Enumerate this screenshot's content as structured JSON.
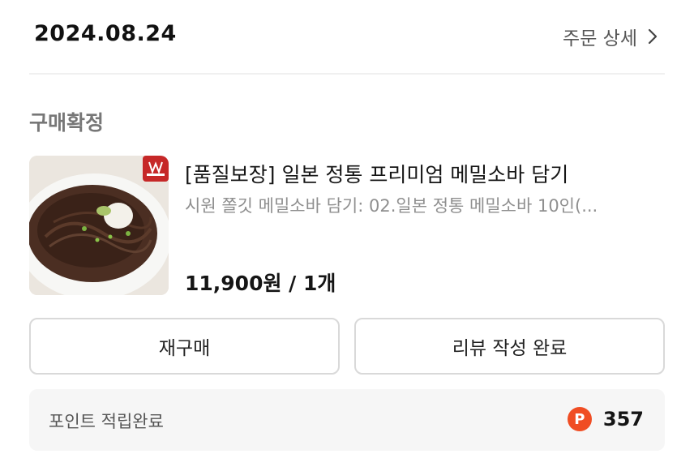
{
  "order": {
    "date": "2024.08.24",
    "detail_link_label": "주문 상세",
    "status": "구매확정"
  },
  "product": {
    "title": "[품질보장] 일본 정통 프리미엄 메밀소바 담기",
    "option": "시원 쫄깃 메밀소바 담기: 02.일본 정통 메밀소바 10인(...",
    "price": "11,900원 / 1개",
    "image_alt": "메밀소바 상품 이미지"
  },
  "actions": {
    "reorder_label": "재구매",
    "review_label": "리뷰 작성 완료"
  },
  "points": {
    "label": "포인트 적립완료",
    "icon_letter": "P",
    "value": "357"
  },
  "colors": {
    "accent": "#f04d23",
    "status_gray": "#777777",
    "panel_bg": "#f6f6f6"
  }
}
